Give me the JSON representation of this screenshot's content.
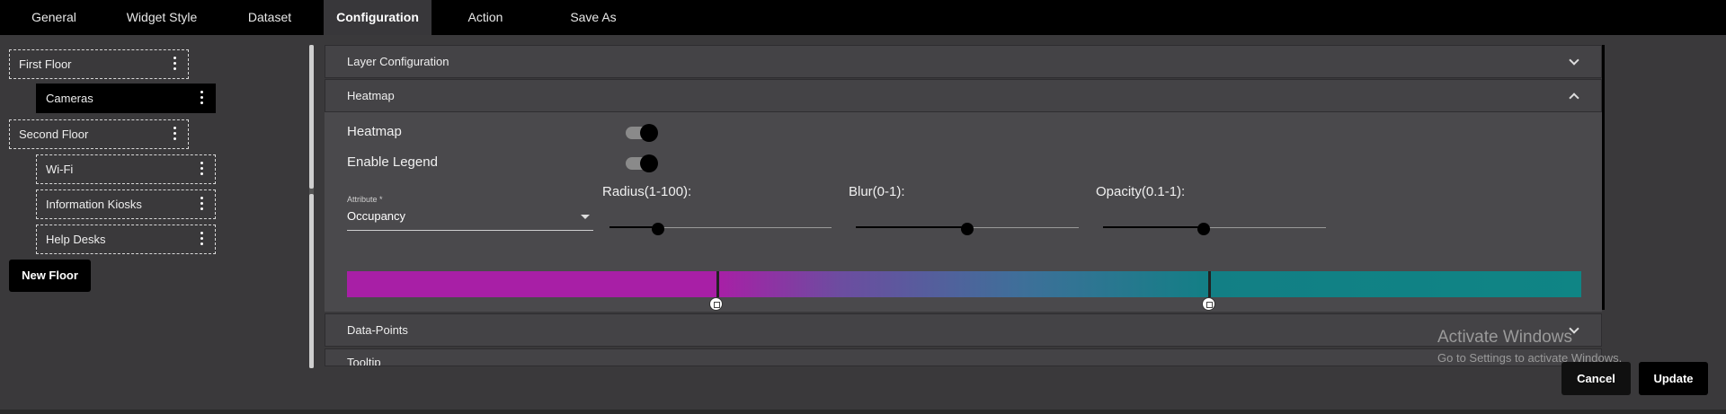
{
  "tabs": [
    "General",
    "Widget Style",
    "Dataset",
    "Configuration",
    "Action",
    "Save As"
  ],
  "sidebar": {
    "items": [
      {
        "label": "First Floor"
      },
      {
        "label": "Cameras"
      },
      {
        "label": "Second Floor"
      },
      {
        "label": "Wi-Fi"
      },
      {
        "label": "Information Kiosks"
      },
      {
        "label": "Help Desks"
      }
    ],
    "new_floor_label": "New Floor"
  },
  "sections": {
    "layer_configuration": "Layer Configuration",
    "heatmap": "Heatmap",
    "data_points": "Data-Points",
    "tooltip": "Tooltip"
  },
  "heatmap": {
    "heatmap_toggle_label": "Heatmap",
    "heatmap_enabled": true,
    "legend_toggle_label": "Enable Legend",
    "legend_enabled": true,
    "attribute_label": "Attribute *",
    "attribute_value": "Occupancy",
    "radius_label": "Radius(1-100):",
    "radius_value_fraction": 0.22,
    "blur_label": "Blur(0-1):",
    "blur_value_fraction": 0.5,
    "opacity_label": "Opacity(0.1-1):",
    "opacity_value_fraction": 0.45,
    "gradient_colors": [
      "#a81fa6",
      "#0f8585"
    ],
    "gradient_stops_fraction": [
      0.3,
      0.7
    ]
  },
  "watermark": {
    "title": "Activate Windows",
    "subtitle": "Go to Settings to activate Windows."
  },
  "footer": {
    "cancel_label": "Cancel",
    "update_label": "Update"
  }
}
